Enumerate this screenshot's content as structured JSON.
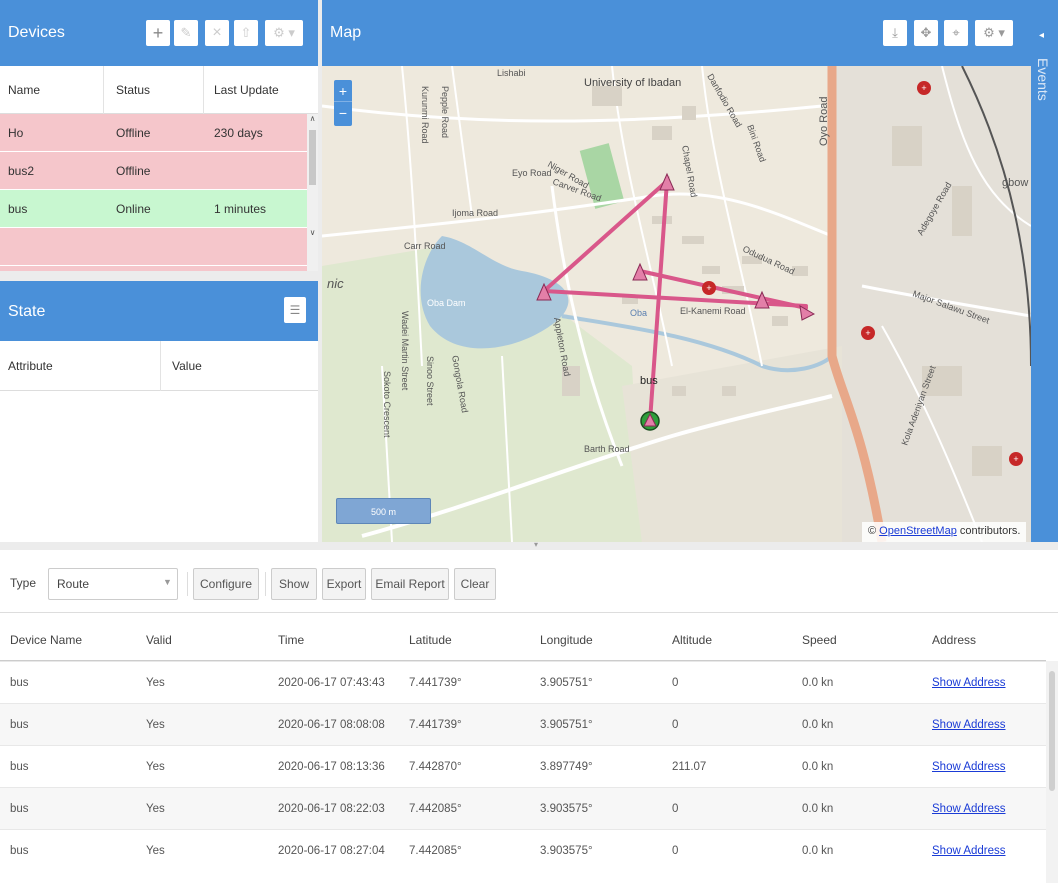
{
  "devices": {
    "title": "Devices",
    "columns": [
      "Name",
      "Status",
      "Last Update"
    ],
    "rows": [
      {
        "name": "Ho",
        "status": "Offline",
        "last_update": "230 days",
        "state": "off"
      },
      {
        "name": "bus2",
        "status": "Offline",
        "last_update": "",
        "state": "off"
      },
      {
        "name": "bus",
        "status": "Online",
        "last_update": "1 minutes",
        "state": "on"
      }
    ],
    "toolbar": {
      "add": "+",
      "edit": "✎",
      "remove": "×",
      "command": "⇧",
      "settings": "⚙ ▾"
    }
  },
  "state": {
    "title": "State",
    "columns": [
      "Attribute",
      "Value"
    ]
  },
  "map": {
    "title": "Map",
    "zoom_in": "+",
    "zoom_out": "−",
    "scale": "500 m",
    "attribution_prefix": "© ",
    "attribution_link": "OpenStreetMap",
    "attribution_suffix": " contributors.",
    "device_label": "bus",
    "place_labels": {
      "university": "University of Ibadan",
      "oyo_road": "Oyo Road",
      "carr_road": "Carr Road",
      "ijoma_road": "Ijoma Road",
      "oba_dam": "Oba Dam",
      "eyo_road": "Eyo Road",
      "niger_road": "Niger Road",
      "carver_road": "Carver Road",
      "appleton_road": "Appleton Road",
      "barth_road": "Barth Road",
      "el_kanemi": "El-Kanemi Road",
      "odudua": "Odudua Road",
      "kola": "Kola Adeniyan Street",
      "major_salawu": "Major Salawu Street",
      "adegoye": "Adegoye Road",
      "oba": "Oba",
      "nic": "nic",
      "gbow": "gbow",
      "wadei": "Wadei Martin Street",
      "sokoto": "Sokoto Crescent",
      "sinoo": "Sinoo Street",
      "gongola": "Gongola Road",
      "kurunmi": "Kurunmi Road",
      "pepple": "Pepple Road",
      "lishabi": "Lishabi",
      "danfodio": "Danfodio Road",
      "chapel": "Chapel Road",
      "bini": "Bini Road"
    },
    "events_label": "Events"
  },
  "report": {
    "type_label": "Type",
    "type_value": "Route",
    "buttons": [
      "Configure",
      "Show",
      "Export",
      "Email Report",
      "Clear"
    ],
    "columns": [
      "Device Name",
      "Valid",
      "Time",
      "Latitude",
      "Longitude",
      "Altitude",
      "Speed",
      "Address"
    ],
    "rows": [
      [
        "bus",
        "Yes",
        "2020-06-17 07:43:43",
        "7.441739°",
        "3.905751°",
        "0",
        "0.0 kn",
        "Show Address"
      ],
      [
        "bus",
        "Yes",
        "2020-06-17 08:08:08",
        "7.441739°",
        "3.905751°",
        "0",
        "0.0 kn",
        "Show Address"
      ],
      [
        "bus",
        "Yes",
        "2020-06-17 08:13:36",
        "7.442870°",
        "3.897749°",
        "211.07",
        "0.0 kn",
        "Show Address"
      ],
      [
        "bus",
        "Yes",
        "2020-06-17 08:22:03",
        "7.442085°",
        "3.903575°",
        "0",
        "0.0 kn",
        "Show Address"
      ],
      [
        "bus",
        "Yes",
        "2020-06-17 08:27:04",
        "7.442085°",
        "3.903575°",
        "0",
        "0.0 kn",
        "Show Address"
      ]
    ]
  },
  "colors": {
    "header": "#4a90d9",
    "offline": "#f5c6cb",
    "online": "#c8f7d0",
    "route": "#d9578a",
    "link": "#1a3bd6"
  }
}
